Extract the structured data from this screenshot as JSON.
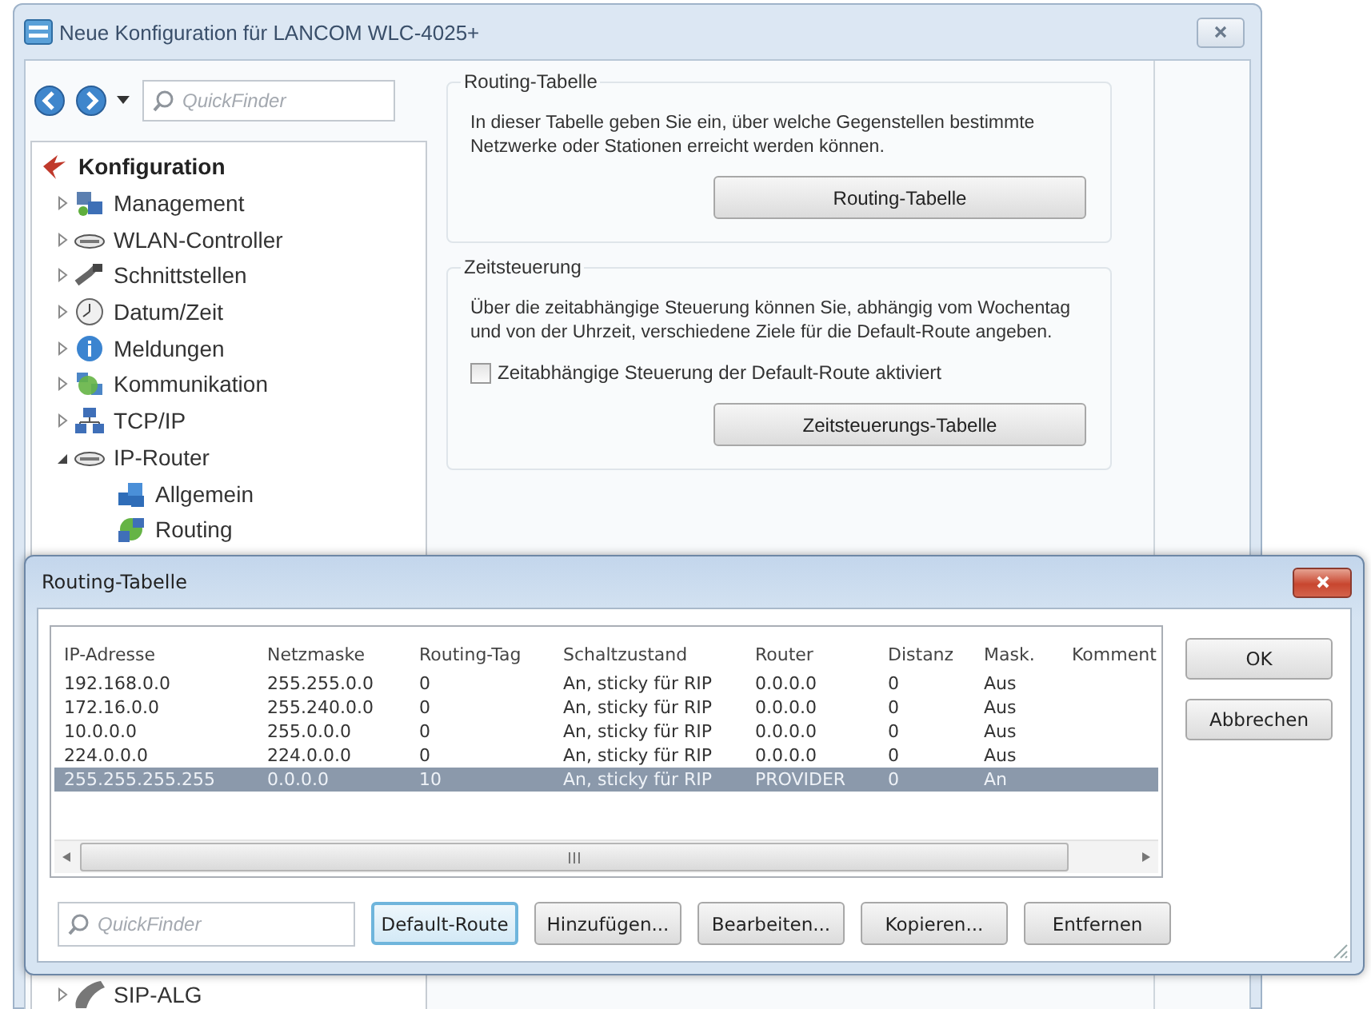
{
  "main_window": {
    "title": "Neue Konfiguration für LANCOM WLC-4025+",
    "quickfinder": {
      "placeholder": "QuickFinder"
    },
    "tree": [
      {
        "label": "Konfiguration",
        "children": [
          {
            "label": "Management",
            "expanded": false
          },
          {
            "label": "WLAN-Controller",
            "expanded": false
          },
          {
            "label": "Schnittstellen",
            "expanded": false
          },
          {
            "label": "Datum/Zeit",
            "expanded": false
          },
          {
            "label": "Meldungen",
            "expanded": false
          },
          {
            "label": "Kommunikation",
            "expanded": false
          },
          {
            "label": "TCP/IP",
            "expanded": false
          },
          {
            "label": "IP-Router",
            "expanded": true,
            "children": [
              {
                "label": "Allgemein"
              },
              {
                "label": "Routing"
              }
            ]
          },
          {
            "label": "SIP-ALG",
            "expanded": false
          }
        ]
      }
    ],
    "groups": [
      {
        "title": "Routing-Tabelle",
        "description": "In dieser Tabelle geben Sie ein, über welche Gegenstellen bestimmte Netzwerke oder Stationen erreicht werden können.",
        "button": "Routing-Tabelle"
      },
      {
        "title": "Zeitsteuerung",
        "description": "Über die zeitabhängige Steuerung können Sie, abhängig vom Wochentag und von der Uhrzeit, verschiedene Ziele für die Default-Route angeben.",
        "checkbox": {
          "label": "Zeitabhängige Steuerung der Default-Route aktiviert",
          "checked": false
        },
        "button": "Zeitsteuerungs-Tabelle"
      }
    ]
  },
  "dialog": {
    "title": "Routing-Tabelle",
    "table": {
      "columns": [
        "IP-Adresse",
        "Netzmaske",
        "Routing-Tag",
        "Schaltzustand",
        "Router",
        "Distanz",
        "Mask.",
        "Komment"
      ],
      "rows": [
        {
          "cells": [
            "192.168.0.0",
            "255.255.0.0",
            "0",
            "An, sticky für RIP",
            "0.0.0.0",
            "0",
            "Aus"
          ],
          "selected": false
        },
        {
          "cells": [
            "172.16.0.0",
            "255.240.0.0",
            "0",
            "An, sticky für RIP",
            "0.0.0.0",
            "0",
            "Aus"
          ],
          "selected": false
        },
        {
          "cells": [
            "10.0.0.0",
            "255.0.0.0",
            "0",
            "An, sticky für RIP",
            "0.0.0.0",
            "0",
            "Aus"
          ],
          "selected": false
        },
        {
          "cells": [
            "224.0.0.0",
            "224.0.0.0",
            "0",
            "An, sticky für RIP",
            "0.0.0.0",
            "0",
            "Aus"
          ],
          "selected": false
        },
        {
          "cells": [
            "255.255.255.255",
            "0.0.0.0",
            "10",
            "An, sticky für RIP",
            "PROVIDER",
            "0",
            "An"
          ],
          "selected": true
        }
      ]
    },
    "side_buttons": [
      "OK",
      "Abbrechen"
    ],
    "quickfinder": {
      "placeholder": "QuickFinder"
    },
    "buttons": [
      {
        "label": "Default-Route",
        "focused": true
      },
      {
        "label": "Hinzufügen...",
        "focused": false
      },
      {
        "label": "Bearbeiten...",
        "focused": false
      },
      {
        "label": "Kopieren...",
        "focused": false
      },
      {
        "label": "Entfernen",
        "focused": false
      }
    ]
  }
}
